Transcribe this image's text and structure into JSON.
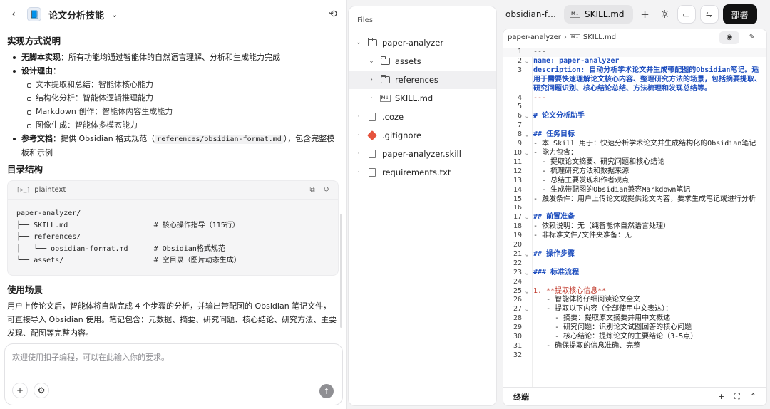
{
  "header": {
    "back_icon": "chevron-left-icon",
    "title": "论文分析技能",
    "history_icon": "history-icon"
  },
  "content": {
    "h_impl": "实现方式说明",
    "b1_label": "无脚本实现",
    "b1_text": "：所有功能均通过智能体的自然语言理解、分析和生成能力完成",
    "b2_label": "设计理由",
    "b2_colon": "：",
    "sub": [
      "文本提取和总结：智能体核心能力",
      "结构化分析：智能体逻辑推理能力",
      "Markdown 创作：智能体内容生成能力",
      "图像生成：智能体多模态能力"
    ],
    "b3_label": "参考文档",
    "b3_text1": "：提供 Obsidian 格式规范（",
    "b3_code": "references/obsidian-format.md",
    "b3_text2": "），包含完整模板和示例",
    "h_dir": "目录结构",
    "code_tag": "[>_]",
    "code_lang": "plaintext",
    "code_lines": "paper-analyzer/\n├── SKILL.md                    # 核心操作指导（115行）\n├── references/\n│   └── obsidian-format.md      # Obsidian格式规范\n└── assets/                     # 空目录（图片动态生成）",
    "h_use": "使用场景",
    "use_text": "用户上传论文后，智能体将自动完成 4 个步骤的分析，并输出带配图的 Obsidian 笔记文件，可直接导入 Obsidian 使用。笔记包含：元数据、摘要、研究问题、核心结论、研究方法、主要发现、配图等完整内容。"
  },
  "input": {
    "placeholder": "欢迎使用扣子编程，可以在此输入你的要求。"
  },
  "files": {
    "title": "Files",
    "items": [
      {
        "label": "paper-analyzer",
        "chev": "⌄",
        "icon": "folder-open-icon"
      },
      {
        "label": "assets",
        "chev": "⌄",
        "icon": "folder-icon"
      },
      {
        "label": "references",
        "chev": "›",
        "icon": "folder-icon"
      },
      {
        "label": "SKILL.md",
        "chev": "",
        "icon": "markdown-file-icon"
      },
      {
        "label": ".coze",
        "chev": "",
        "icon": "file-icon"
      },
      {
        "label": ".gitignore",
        "chev": "",
        "icon": "git-icon"
      },
      {
        "label": "paper-analyzer.skill",
        "chev": "",
        "icon": "file-icon"
      },
      {
        "label": "requirements.txt",
        "chev": "",
        "icon": "text-file-icon"
      }
    ]
  },
  "tabs": {
    "tab1": "obsidian-f…",
    "tab2": "SKILL.md",
    "deploy": "部署"
  },
  "editor": {
    "crumb1": "paper-analyzer",
    "crumb2": "SKILL.md",
    "lines": [
      {
        "n": "1",
        "f": "",
        "c": "---",
        "cls": ""
      },
      {
        "n": "2",
        "f": "⌄",
        "c": "name: paper-analyzer",
        "cls": "k"
      },
      {
        "n": "3",
        "f": "",
        "c": "description: 自动分析学术论文并生成带配图的Obsidian笔记。适用于需要快速理解论文核心内容、整理研究方法的场景，包括摘要提取、研究问题识别、核心结论总结、方法梳理和发现总结等。",
        "cls": "k"
      },
      {
        "n": "4",
        "f": "",
        "c": "---",
        "cls": "r"
      },
      {
        "n": "5",
        "f": "",
        "c": "",
        "cls": ""
      },
      {
        "n": "6",
        "f": "⌄",
        "c": "# 论文分析助手",
        "cls": "h"
      },
      {
        "n": "7",
        "f": "",
        "c": "",
        "cls": ""
      },
      {
        "n": "8",
        "f": "⌄",
        "c": "## 任务目标",
        "cls": "h"
      },
      {
        "n": "9",
        "f": "",
        "c": "- 本 Skill 用于：快速分析学术论文并生成结构化的Obsidian笔记",
        "cls": ""
      },
      {
        "n": "10",
        "f": "⌄",
        "c": "- 能力包含：",
        "cls": ""
      },
      {
        "n": "11",
        "f": "",
        "c": "  - 提取论文摘要、研究问题和核心结论",
        "cls": ""
      },
      {
        "n": "12",
        "f": "",
        "c": "  - 梳理研究方法和数据来源",
        "cls": ""
      },
      {
        "n": "13",
        "f": "",
        "c": "  - 总结主要发现和作者观点",
        "cls": ""
      },
      {
        "n": "14",
        "f": "",
        "c": "  - 生成带配图的Obsidian兼容Markdown笔记",
        "cls": ""
      },
      {
        "n": "15",
        "f": "",
        "c": "- 触发条件：用户上传论文或提供论文内容，要求生成笔记或进行分析",
        "cls": ""
      },
      {
        "n": "16",
        "f": "",
        "c": "",
        "cls": ""
      },
      {
        "n": "17",
        "f": "⌄",
        "c": "## 前置准备",
        "cls": "h"
      },
      {
        "n": "18",
        "f": "",
        "c": "- 依赖说明：无（纯智能体自然语言处理）",
        "cls": ""
      },
      {
        "n": "19",
        "f": "",
        "c": "- 非标准文件/文件夹准备：无",
        "cls": ""
      },
      {
        "n": "20",
        "f": "",
        "c": "",
        "cls": ""
      },
      {
        "n": "21",
        "f": "⌄",
        "c": "## 操作步骤",
        "cls": "h"
      },
      {
        "n": "22",
        "f": "",
        "c": "",
        "cls": ""
      },
      {
        "n": "23",
        "f": "⌄",
        "c": "### 标准流程",
        "cls": "h"
      },
      {
        "n": "24",
        "f": "",
        "c": "",
        "cls": ""
      },
      {
        "n": "25",
        "f": "⌄",
        "c": "1. **提取核心信息**",
        "cls": "r"
      },
      {
        "n": "26",
        "f": "",
        "c": "   - 智能体将仔细阅读论文全文",
        "cls": ""
      },
      {
        "n": "27",
        "f": "⌄",
        "c": "   - 提取以下内容（全部使用中文表达）：",
        "cls": ""
      },
      {
        "n": "28",
        "f": "",
        "c": "     - 摘要：提取原文摘要并用中文概述",
        "cls": ""
      },
      {
        "n": "29",
        "f": "",
        "c": "     - 研究问题：识别论文试图回答的核心问题",
        "cls": ""
      },
      {
        "n": "30",
        "f": "",
        "c": "     - 核心结论：提炼论文的主要结论（3-5点）",
        "cls": ""
      },
      {
        "n": "31",
        "f": "",
        "c": "   - 确保提取的信息准确、完整",
        "cls": ""
      },
      {
        "n": "32",
        "f": "",
        "c": "",
        "cls": ""
      }
    ]
  },
  "terminal": {
    "label": "终端"
  }
}
